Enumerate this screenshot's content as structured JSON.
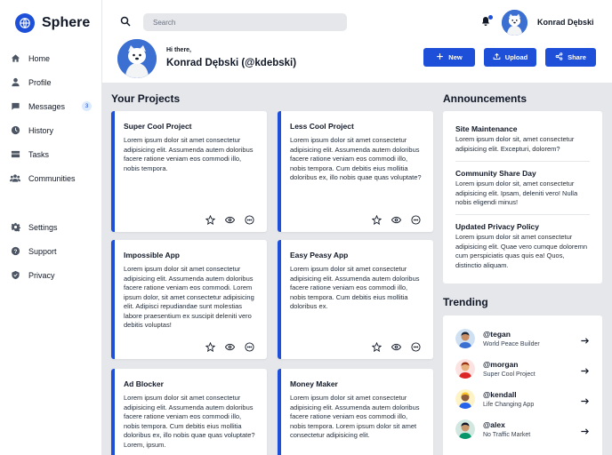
{
  "app": {
    "name": "Sphere",
    "accent": "#1e4fd8"
  },
  "sidebar": {
    "primary": [
      {
        "label": "Home",
        "icon": "home-icon"
      },
      {
        "label": "Profile",
        "icon": "user-icon"
      },
      {
        "label": "Messages",
        "icon": "chat-icon",
        "badge": "3"
      },
      {
        "label": "History",
        "icon": "clock-icon"
      },
      {
        "label": "Tasks",
        "icon": "inbox-icon"
      },
      {
        "label": "Communities",
        "icon": "users-icon"
      }
    ],
    "secondary": [
      {
        "label": "Settings",
        "icon": "gear-icon"
      },
      {
        "label": "Support",
        "icon": "help-icon"
      },
      {
        "label": "Privacy",
        "icon": "shield-icon"
      }
    ]
  },
  "header": {
    "search_placeholder": "Search",
    "user_name": "Konrad Dębski",
    "greeting": "Hi there,",
    "full_name": "Konrad Dębski (@kdebski)",
    "buttons": {
      "new": "New",
      "upload": "Upload",
      "share": "Share"
    }
  },
  "projects": {
    "title": "Your Projects",
    "items": [
      {
        "title": "Super Cool Project",
        "desc": "Lorem ipsum dolor sit amet consectetur adipisicing elit. Assumenda autem doloribus facere ratione veniam eos commodi illo, nobis tempora."
      },
      {
        "title": "Less Cool Project",
        "desc": "Lorem ipsum dolor sit amet consectetur adipisicing elit. Assumenda autem doloribus facere ratione veniam eos commodi illo, nobis tempora. Cum debitis eius mollitia doloribus ex, illo nobis quae quas voluptate?"
      },
      {
        "title": "Impossible App",
        "desc": "Lorem ipsum dolor sit amet consectetur adipisicing elit. Assumenda autem doloribus facere ratione veniam eos commodi. Lorem ipsum dolor, sit amet consectetur adipisicing elit. Adipisci repudiandae sunt molestias labore praesentium ex suscipit deleniti vero debitis voluptas!"
      },
      {
        "title": "Easy Peasy App",
        "desc": "Lorem ipsum dolor sit amet consectetur adipisicing elit. Assumenda autem doloribus facere ratione veniam eos commodi illo, nobis tempora. Cum debitis eius mollitia doloribus ex."
      },
      {
        "title": "Ad Blocker",
        "desc": "Lorem ipsum dolor sit amet consectetur adipisicing elit. Assumenda autem doloribus facere ratione veniam eos commodi illo, nobis tempora. Cum debitis eius mollitia doloribus ex, illo nobis quae quas voluptate? Lorem, ipsum."
      },
      {
        "title": "Money Maker",
        "desc": "Lorem ipsum dolor sit amet consectetur adipisicing elit. Assumenda autem doloribus facere ratione veniam eos commodi illo, nobis tempora. Lorem ipsum dolor sit amet consectetur adipisicing elit."
      }
    ]
  },
  "announcements": {
    "title": "Announcements",
    "items": [
      {
        "title": "Site Maintenance",
        "desc": "Lorem ipsum dolor sit, amet consectetur adipisicing elit. Excepturi, dolorem?"
      },
      {
        "title": "Community Share Day",
        "desc": "Lorem ipsum dolor sit, amet consectetur adipisicing elit. Ipsam, deleniti vero! Nulla nobis eligendi minus!"
      },
      {
        "title": "Updated Privacy Policy",
        "desc": "Lorem ipsum dolor sit amet consectetur adipisicing elit. Quae vero cumque doloremn cum perspiciatis quas quis ea! Quos, distinctio aliquam."
      }
    ]
  },
  "trending": {
    "title": "Trending",
    "items": [
      {
        "handle": "@tegan",
        "sub": "World Peace Builder",
        "bg": "#cfe0f3",
        "skin": "#c98e63",
        "hair": "#1f2937",
        "shirt": "#3b6fd1"
      },
      {
        "handle": "@morgan",
        "sub": "Super Cool Project",
        "bg": "#fde2e2",
        "skin": "#e8b07d",
        "hair": "#9a3412",
        "shirt": "#dc2626"
      },
      {
        "handle": "@kendall",
        "sub": "Life Changing App",
        "bg": "#fef3c7",
        "skin": "#8d5a3b",
        "hair": "#fbbf24",
        "shirt": "#2563eb"
      },
      {
        "handle": "@alex",
        "sub": "No Traffic Market",
        "bg": "#d1e7e0",
        "skin": "#c9976c",
        "hair": "#111827",
        "shirt": "#059669"
      }
    ]
  }
}
